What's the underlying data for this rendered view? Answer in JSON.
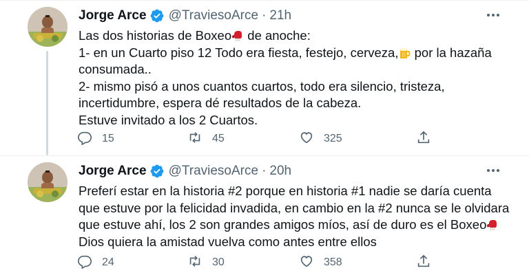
{
  "tweets": [
    {
      "author": "Jorge Arce",
      "handle": "@TraviesoArce",
      "separator": "·",
      "time": "21h",
      "lines": [
        "Las dos historias de Boxeo",
        " de anoche:",
        "1- en un Cuarto piso 12 Todo era fiesta, festejo, cerveza,",
        " por la hazaña",
        "consumada..",
        "2- mismo pisó a unos cuantos cuartos, todo era silencio, tristeza,",
        "incertidumbre, espera dé resultados de la cabeza.",
        "Estuve invitado a los 2 Cuartos."
      ],
      "emojis": [
        "boxing-glove",
        "beer-mug"
      ],
      "replies": "15",
      "retweets": "45",
      "likes": "325"
    },
    {
      "author": "Jorge Arce",
      "handle": "@TraviesoArce",
      "separator": "·",
      "time": "20h",
      "lines": [
        "Preferí estar en la historia #2 porque en historia #1 nadie se daría cuenta",
        "que estuve por la felicidad invadida, en cambio en la #2 nunca se le olvidara",
        "que estuve ahí, los 2 son grandes amigos míos, así de duro es el Boxeo",
        "Dios quiera la amistad vuelva como antes entre ellos"
      ],
      "emojis": [
        "boxing-glove"
      ],
      "replies": "24",
      "retweets": "30",
      "likes": "358"
    }
  ],
  "colors": {
    "text": "#0f1419",
    "secondary": "#536471",
    "verified": "#1d9bf0",
    "thread_line": "#cfd9de",
    "glove": "#d4202c"
  },
  "icons": [
    "more-icon",
    "verified-icon",
    "reply-icon",
    "retweet-icon",
    "like-icon",
    "share-icon"
  ]
}
